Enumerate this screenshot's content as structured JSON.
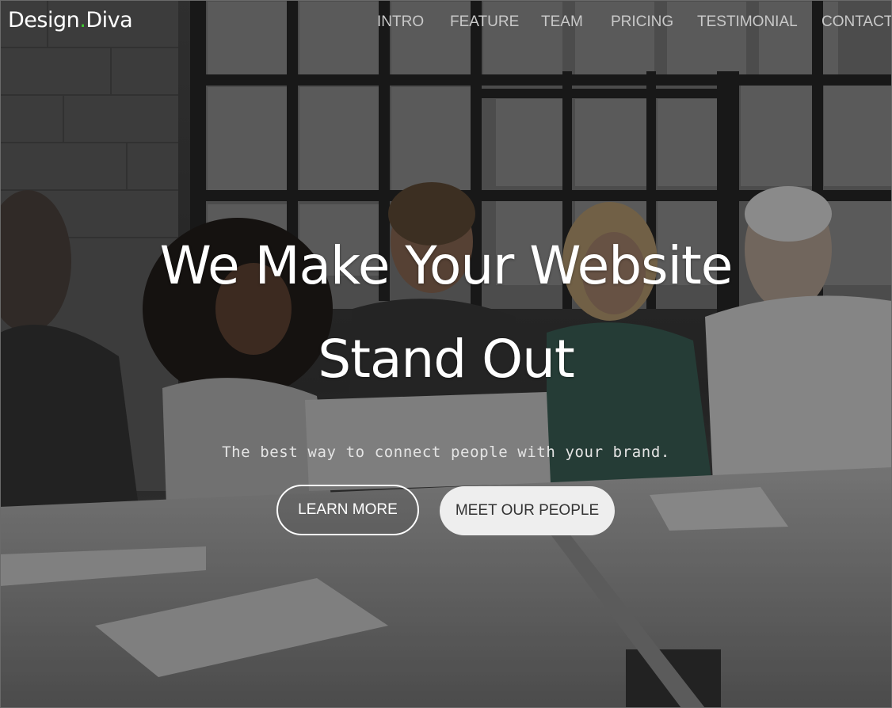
{
  "brand": {
    "name_part1": "Design",
    "dot": ".",
    "name_part2": "Diva",
    "accent_color": "#3ecb2f"
  },
  "nav": {
    "items": [
      {
        "label": "INTRO"
      },
      {
        "label": "FEATURE"
      },
      {
        "label": "TEAM"
      },
      {
        "label": "PRICING"
      },
      {
        "label": "TESTIMONIAL"
      },
      {
        "label": "CONTACT"
      }
    ]
  },
  "hero": {
    "headline_line1": "We Make Your Website",
    "headline_line2": "Stand Out",
    "subheadline": "The best way to connect people with your brand.",
    "primary_button": "LEARN MORE",
    "secondary_button": "MEET OUR PEOPLE",
    "background_image": "team-meeting-photo"
  }
}
